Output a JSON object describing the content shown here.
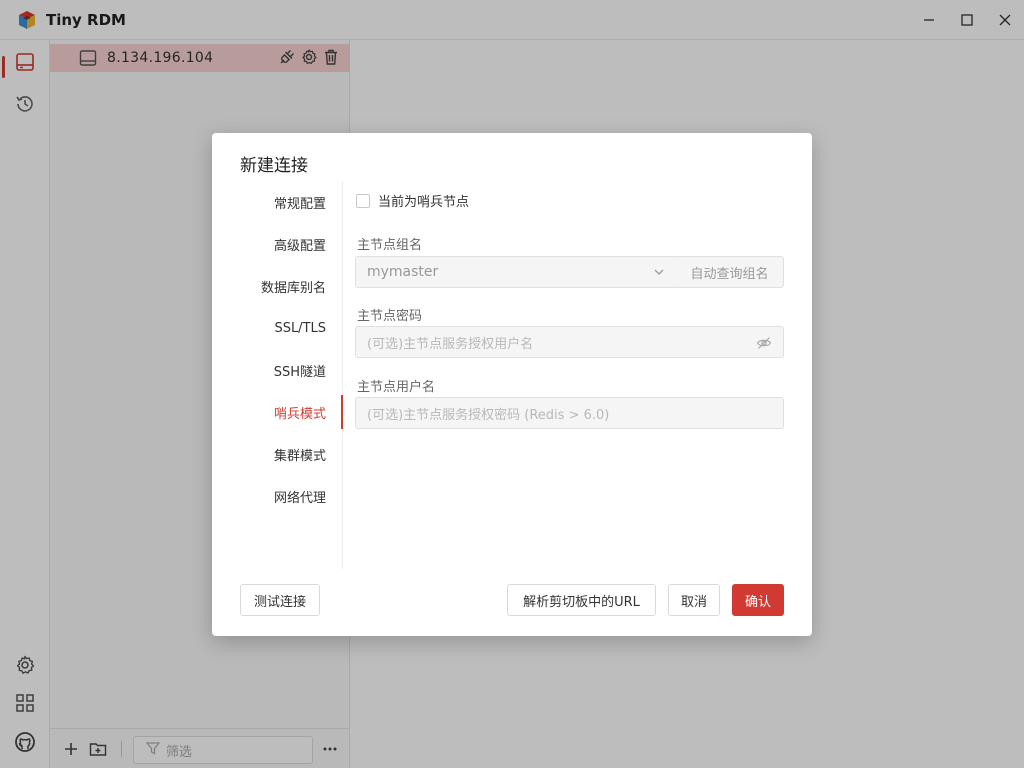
{
  "app": {
    "title": "Tiny RDM"
  },
  "connections": [
    {
      "name": "8.134.196.104"
    }
  ],
  "sidebar_bottom": {
    "filter_placeholder": "筛选"
  },
  "dialog": {
    "title": "新建连接",
    "tabs": [
      {
        "label": "常规配置"
      },
      {
        "label": "高级配置"
      },
      {
        "label": "数据库别名"
      },
      {
        "label": "SSL/TLS"
      },
      {
        "label": "SSH隧道"
      },
      {
        "label": "哨兵模式"
      },
      {
        "label": "集群模式"
      },
      {
        "label": "网络代理"
      }
    ],
    "active_tab": "哨兵模式",
    "sentinel": {
      "checkbox_label": "当前为哨兵节点",
      "checked": false,
      "master_name_label": "主节点组名",
      "master_name_value": "mymaster",
      "auto_query_label": "自动查询组名",
      "password_label": "主节点密码",
      "password_placeholder": "(可选)主节点服务授权用户名",
      "username_label": "主节点用户名",
      "username_placeholder": "(可选)主节点服务授权密码 (Redis > 6.0)"
    },
    "footer": {
      "test_label": "测试连接",
      "parse_url_label": "解析剪切板中的URL",
      "cancel_label": "取消",
      "confirm_label": "确认"
    }
  },
  "colors": {
    "accent": "#d03a32",
    "selected_row": "#f8d3d1"
  }
}
